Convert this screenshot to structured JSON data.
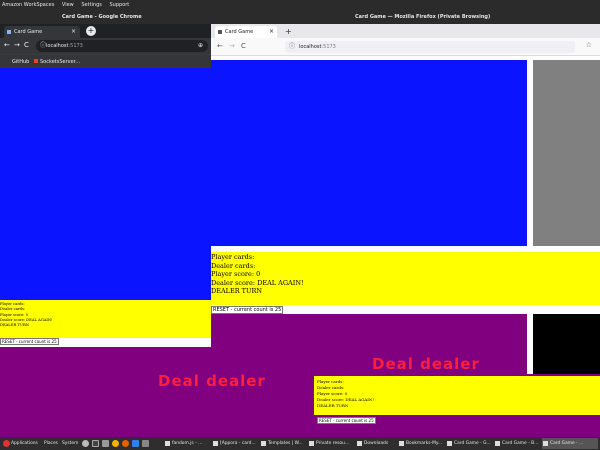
{
  "os": {
    "menu": [
      "Amazon WorkSpaces",
      "View",
      "Settings",
      "Support"
    ],
    "chrome_title": "Card Game - Google Chrome",
    "firefox_title": "Card Game — Mozilla Firefox (Private Browsing)"
  },
  "firefox": {
    "tab_label": "Card Game",
    "tab_close": "×",
    "new_tab": "+",
    "back": "←",
    "forward": "→",
    "reload": "C",
    "info": "ⓘ",
    "url_host": "localhost",
    "url_port": ":5173",
    "star": "☆",
    "colors": {
      "blue": "#0a14ff",
      "gray": "#808080",
      "yellow": "#ffff00",
      "purple": "#800080",
      "black": "#000000"
    },
    "status": {
      "player_cards": "Player cards:",
      "dealer_cards": "Dealer cards:",
      "player_score": "Player score: 0",
      "dealer_score": "Dealer score: DEAL AGAIN!",
      "turn": "DEALER TURN"
    },
    "reset_button": "RESET - current count is 25"
  },
  "chrome": {
    "tab_label": "Card Game",
    "tab_close": "×",
    "new_tab": "+",
    "back": "←",
    "forward": "→",
    "reload": "C",
    "info": "ⓘ",
    "url_host": "localhost",
    "url_port": ":5173",
    "zoom": "⊕",
    "bookmarks": [
      "GitHub",
      "SocketsServer..."
    ],
    "status": {
      "player_cards": "Player cards:",
      "dealer_cards": "Dealer cards:",
      "player_score": "Player score: 0",
      "dealer_score": "Dealer score: DEAL AGAIN!",
      "turn": "DEALER TURN"
    },
    "reset_button": "RESET - current count is 25"
  },
  "captions": {
    "deal_dealer_1": "Deal dealer",
    "deal_dealer_2": "Deal dealer"
  },
  "popup": {
    "status": {
      "player_cards": "Player cards:",
      "dealer_cards": "Dealer cards:",
      "player_score": "Player score: 0",
      "dealer_score": "Dealer score: DEAL AGAIN!",
      "turn": "DEALER TURN"
    },
    "reset_button": "RESET - current count is 25"
  },
  "taskbar": {
    "menus": [
      "Applications",
      "Places",
      "System"
    ],
    "tasks": [
      "fandom.js - ...",
      "[Appora - card...",
      "Templates | W...",
      "Private resou...",
      "Downloads",
      "Bookmarks-My...",
      "Card Game - G...",
      "Card Game - B...",
      "Card Game - ..."
    ]
  }
}
